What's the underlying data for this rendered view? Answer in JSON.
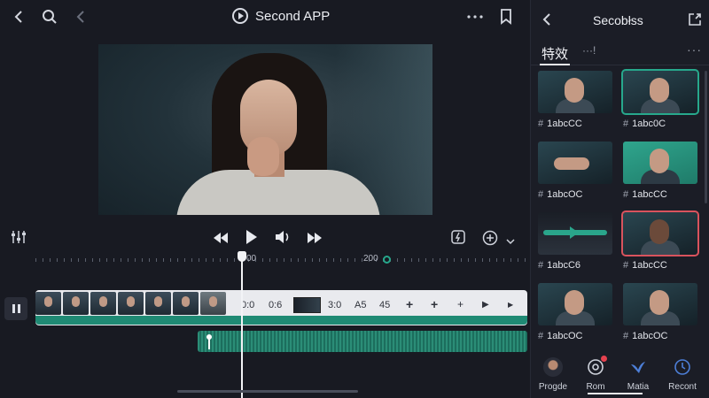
{
  "header": {
    "title": "Second APP",
    "icons": [
      "back-arrow-icon",
      "search-icon",
      "back-arrow-dim-icon",
      "play-circle-icon",
      "more-dots-icon",
      "bookmark-icon"
    ]
  },
  "controls": {
    "icons": [
      "settings-sliders-icon",
      "rewind-icon",
      "play-icon",
      "volume-icon",
      "fast-forward-icon",
      "lightning-box-icon",
      "add-circle-icon",
      "chevron-down-icon"
    ]
  },
  "ruler": {
    "label_playhead": "00",
    "label_end": "200"
  },
  "track": {
    "items": [
      "0:0",
      "0:6",
      "3:0",
      "A5",
      "45",
      "+",
      "+",
      "+",
      "▶",
      "▶"
    ]
  },
  "panel": {
    "title": "Secobłss",
    "tab_active": "特效",
    "tab_more": "···!",
    "cards": [
      {
        "label": "1abcCC",
        "style": "dark"
      },
      {
        "label": "1abc0C",
        "style": "selected"
      },
      {
        "label": "1abcOC",
        "style": "dark"
      },
      {
        "label": "1abcCC",
        "style": "teal"
      },
      {
        "label": "1abcC6",
        "style": "dark"
      },
      {
        "label": "1abcCC",
        "style": "red"
      },
      {
        "label": "1abcOC",
        "style": "dark"
      },
      {
        "label": "1abcOC",
        "style": "dark"
      }
    ]
  },
  "bottom_nav": [
    {
      "label": "Progde",
      "icon": "avatar-icon"
    },
    {
      "label": "Rom",
      "icon": "target-icon"
    },
    {
      "label": "Matia",
      "icon": "bird-icon"
    },
    {
      "label": "Recont",
      "icon": "clock-icon"
    }
  ],
  "colors": {
    "accent": "#27a88c",
    "background": "#181a22",
    "alert": "#e6424f"
  }
}
